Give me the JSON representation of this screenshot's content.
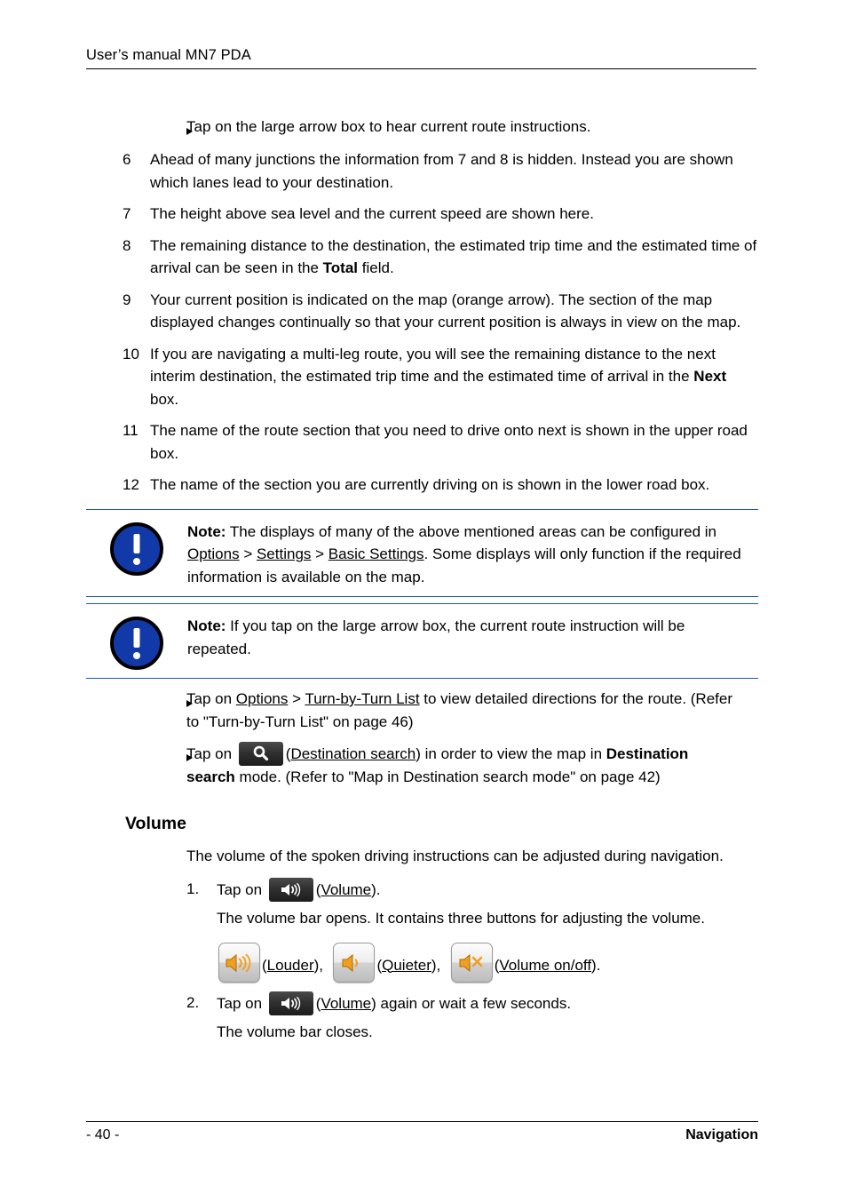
{
  "header": {
    "title": "User’s manual MN7 PDA"
  },
  "list_items": [
    {
      "type": "bullet",
      "text": "Tap on the large arrow box to hear current route instructions."
    },
    {
      "type": "numbered",
      "num": "6",
      "text": "Ahead of many junctions the information from 7 and 8 is hidden. Instead you are shown which lanes lead to your destination."
    },
    {
      "type": "numbered",
      "num": "7",
      "text": "The height above sea level and the current speed are shown here."
    },
    {
      "type": "numbered",
      "num": "8",
      "text_before": "The remaining distance to the destination, the estimated trip time and the estimated time of arrival can be seen in the ",
      "bold": "Total",
      "text_after": " field."
    },
    {
      "type": "numbered",
      "num": "9",
      "text": "Your current position is indicated on the map (orange arrow).  The section of the map displayed changes continually so that your current position is always in view on the map."
    },
    {
      "type": "numbered",
      "num": "10",
      "text_before": "If you are navigating a multi-leg route, you will see the remaining distance to the next interim destination, the estimated trip time and the estimated time of arrival in the ",
      "bold": "Next",
      "text_after": " box."
    },
    {
      "type": "numbered",
      "num": "11",
      "text": "The name of the route section that you need to drive onto next is shown in the upper road box."
    },
    {
      "type": "numbered",
      "num": "12",
      "text": "The name of the section you are currently driving on is shown in the lower road box."
    }
  ],
  "notes": [
    {
      "label": "Note:",
      "icon": "exclamation-circle-icon",
      "part1": " The displays of many of the above mentioned areas can be configured in ",
      "link1": "Options",
      "sep1": " > ",
      "link2": "Settings",
      "sep2": " > ",
      "link3": "Basic Settings",
      "part2": ". Some displays will only function if the required information is available on the map."
    },
    {
      "label": "Note:",
      "icon": "exclamation-circle-icon",
      "part1": " If you tap on the large arrow box, the current route instruction will be repeated.",
      "link1": "",
      "sep1": "",
      "link2": "",
      "sep2": "",
      "link3": "",
      "part2": ""
    }
  ],
  "post_note_bullets": [
    {
      "pre": "Tap on ",
      "link1": "Options",
      "mid": " > ",
      "link2": "Turn-by-Turn List",
      "post": " to view detailed directions for the route. (Refer to \"Turn-by-Turn List\" on page 46)"
    },
    {
      "pre": "Tap on ",
      "icon": "search-icon",
      "open_paren": "(",
      "link1": "Destination search",
      "close_paren": ")",
      "mid": " in order to view the map in ",
      "bold": "Destination search",
      "post": " mode. (Refer to \"Map in Destination search mode\" on page 42)"
    }
  ],
  "volume_section": {
    "heading": "Volume",
    "intro": "The volume of the spoken driving instructions can be adjusted during navigation.",
    "step1": {
      "num": "1.",
      "pre": "Tap on ",
      "icon": "volume-icon",
      "open_paren": "(",
      "link": "Volume",
      "close_paren": ").",
      "post": ""
    },
    "step1_detail": "The volume bar opens. It contains three buttons for adjusting the volume.",
    "buttons": [
      {
        "icon": "speaker-louder-icon",
        "open_paren": "(",
        "label": "Louder",
        "close_paren": "),"
      },
      {
        "icon": "speaker-quieter-icon",
        "open_paren": "(",
        "label": "Quieter",
        "close_paren": "),"
      },
      {
        "icon": "speaker-mute-icon",
        "open_paren": "(",
        "label": "Volume on/off",
        "close_paren": ")."
      }
    ],
    "step2": {
      "num": "2.",
      "pre": "Tap on ",
      "icon": "volume-icon",
      "open_paren": "(",
      "link": "Volume",
      "close_paren": ")",
      "post": " again or wait a few seconds."
    },
    "step2_detail": "The volume bar closes."
  },
  "footer": {
    "page_number": "- 40 -",
    "section": "Navigation"
  },
  "colors": {
    "note_rule": "#1a56c4",
    "note_icon_fill": "#1239a8",
    "speaker_orange": "#f0a020",
    "text": "#000000"
  }
}
